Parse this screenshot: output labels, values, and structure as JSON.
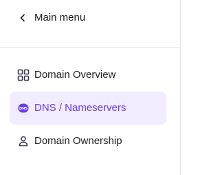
{
  "back": {
    "label": "Main menu",
    "icon": "chevron-left-icon"
  },
  "nav": {
    "items": [
      {
        "label": "Domain Overview",
        "icon": "grid-overview-icon",
        "active": false
      },
      {
        "label": "DNS / Nameservers",
        "icon": "dns-icon",
        "active": true
      },
      {
        "label": "Domain Ownership",
        "icon": "user-icon",
        "active": false
      }
    ]
  },
  "colors": {
    "accent": "#673de6",
    "active_background": "#f1ecff",
    "text": "#1d1e20",
    "icon": "#36344d",
    "divider": "#e3e3e8"
  }
}
